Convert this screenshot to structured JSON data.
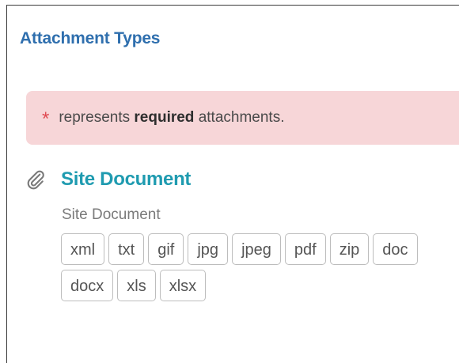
{
  "section": {
    "title": "Attachment Types"
  },
  "notice": {
    "asterisk": "*",
    "text_before": "represents ",
    "text_bold": "required",
    "text_after": " attachments."
  },
  "attachment": {
    "icon": "paperclip-icon",
    "title": "Site Document",
    "subtitle": "Site Document",
    "types": [
      "xml",
      "txt",
      "gif",
      "jpg",
      "jpeg",
      "pdf",
      "zip",
      "doc",
      "docx",
      "xls",
      "xlsx"
    ]
  },
  "colors": {
    "title_blue": "#2f6fae",
    "doc_title_teal": "#1f9bb0",
    "notice_bg": "#f7d6d8",
    "asterisk_red": "#e04a52"
  }
}
